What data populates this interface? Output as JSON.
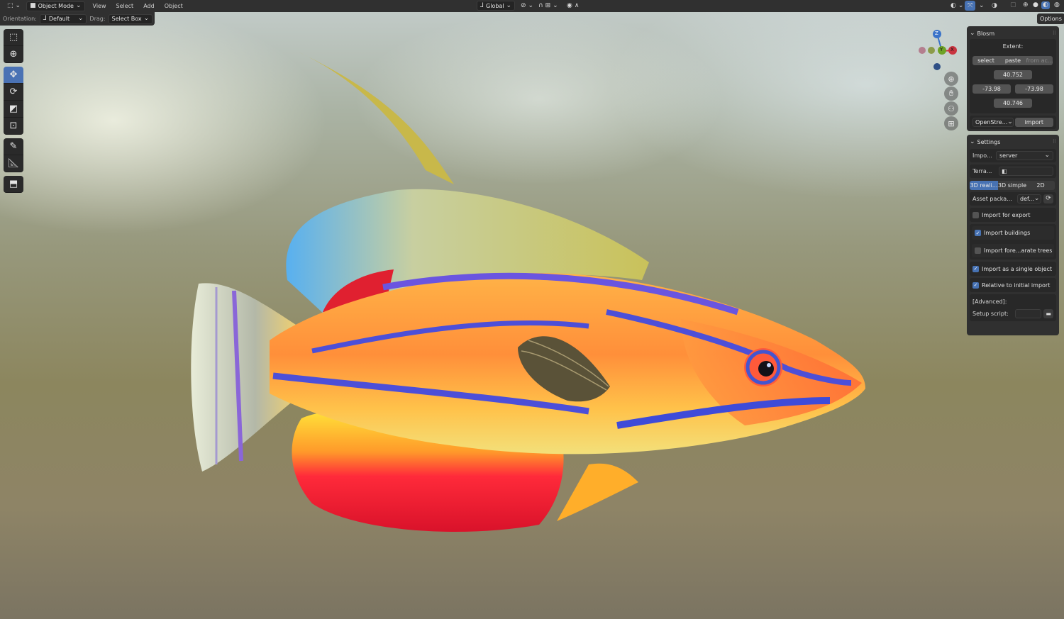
{
  "header": {
    "mode": "Object Mode",
    "menus": [
      "View",
      "Select",
      "Add",
      "Object"
    ],
    "transform_orientation": "Global",
    "options_label": "Options"
  },
  "tool_header": {
    "orientation_label": "Orientation:",
    "orientation_value": "Default",
    "drag_label": "Drag:",
    "drag_value": "Select Box"
  },
  "toolbar": {
    "active_tool": "move-tool"
  },
  "gizmo": {
    "z": "Z",
    "y": "Y",
    "x": "X"
  },
  "blosm": {
    "title": "Blosm",
    "extent_label": "Extent:",
    "select_label": "select",
    "paste_label": "paste",
    "from_label": "from ac...",
    "top": "40.752",
    "left": "-73.98",
    "right": "-73.98",
    "bottom": "40.746",
    "source": "OpenStre...",
    "import_label": "import"
  },
  "settings": {
    "title": "Settings",
    "impo_label": "Impo...",
    "impo_value": "server",
    "terrain_label": "Terra...",
    "modes": [
      "3D reali...",
      "3D simple",
      "2D"
    ],
    "asset_label": "Asset packa...",
    "asset_value": "def...",
    "import_for_export": "Import for export",
    "import_buildings": "Import buildings",
    "import_forests": "Import fore...arate trees",
    "single_object": "Import as a single object",
    "relative_initial": "Relative to initial import",
    "advanced_label": "[Advanced]:",
    "setup_script_label": "Setup script:"
  },
  "colors": {
    "accent": "#4772b3",
    "panel": "#303030",
    "header": "#303030"
  }
}
